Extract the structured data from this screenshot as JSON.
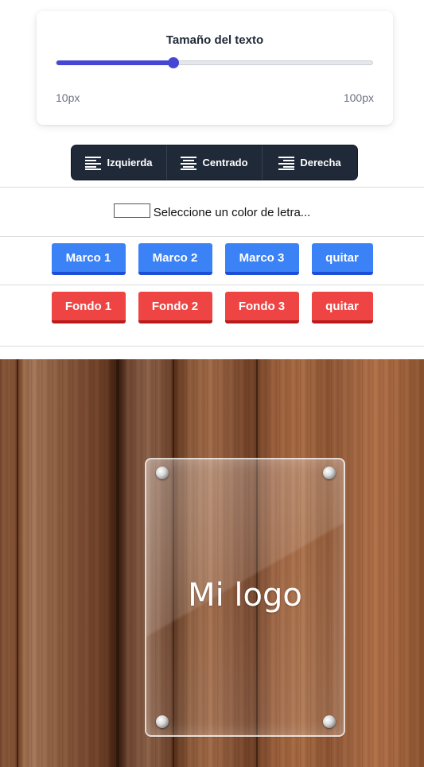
{
  "text_size": {
    "title": "Tamaño del texto",
    "min_label": "10px",
    "max_label": "100px",
    "value_fraction": 0.37
  },
  "alignment": {
    "items": [
      {
        "label": "Izquierda",
        "icon": "align-left-icon"
      },
      {
        "label": "Centrado",
        "icon": "align-center-icon"
      },
      {
        "label": "Derecha",
        "icon": "align-right-icon"
      }
    ]
  },
  "font_color": {
    "label": "Seleccione un color de letra...",
    "value": "#ffffff"
  },
  "frame_buttons": [
    "Marco 1",
    "Marco 2",
    "Marco 3",
    "quitar"
  ],
  "background_buttons": [
    "Fondo 1",
    "Fondo 2",
    "Fondo 3",
    "quitar"
  ],
  "preview": {
    "logo_text": "Mi logo"
  },
  "colors": {
    "slider": "#4646d4",
    "toolbar": "#1f2937",
    "frame_button": "#3b82f6",
    "background_button": "#ef4444"
  }
}
